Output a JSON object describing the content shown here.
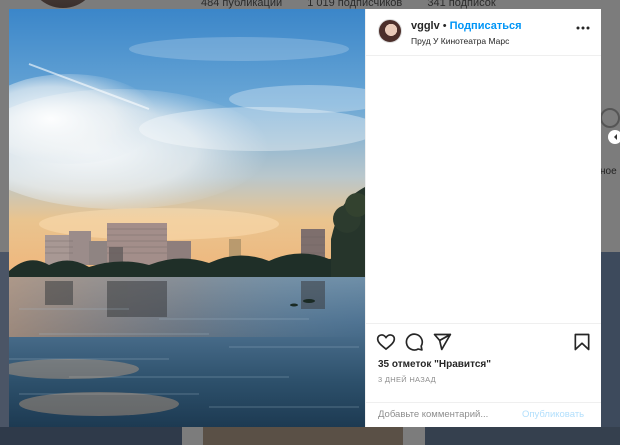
{
  "background": {
    "stats": [
      "484 публикаций",
      "1 019 подписчиков",
      "341 подписок"
    ],
    "side_text": "ное"
  },
  "post": {
    "photo_alt": "city-lake-sunset-photo",
    "username": "vgglv",
    "separator": "•",
    "follow_label": "Подписаться",
    "location": "Пруд У Кинотеатра Марс",
    "more_label": "•••",
    "likes": "35 отметок \"Нравится\"",
    "date": "3 ДНЕЙ НАЗАД",
    "comment_placeholder": "Добавьте комментарий...",
    "publish_label": "Опубликовать",
    "icons": [
      "heart-icon",
      "comment-icon",
      "share-icon",
      "bookmark-icon"
    ]
  },
  "colors": {
    "accent": "#0095f6",
    "publish_disabled": "#b2dffc",
    "overlay": "#7b7b7b"
  }
}
